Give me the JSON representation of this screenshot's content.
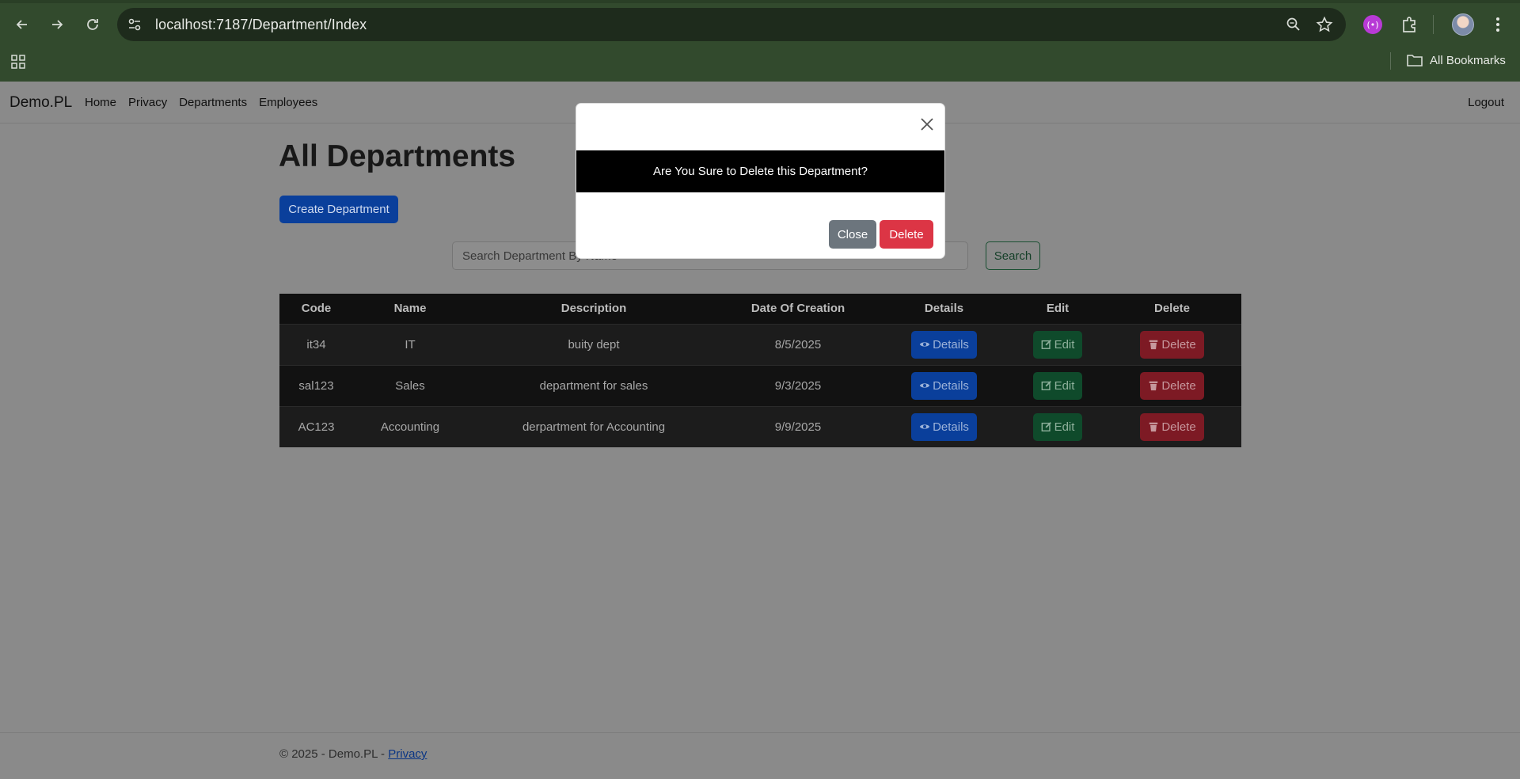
{
  "browser": {
    "url": "localhost:7187/Department/Index",
    "bookmarks_label": "All Bookmarks"
  },
  "navbar": {
    "brand": "Demo.PL",
    "links": [
      "Home",
      "Privacy",
      "Departments",
      "Employees"
    ],
    "logout": "Logout"
  },
  "main": {
    "title": "All Departments",
    "create_label": "Create Department",
    "search_placeholder": "Search Department By Name",
    "search_label": "Search"
  },
  "table": {
    "headers": [
      "Code",
      "Name",
      "Description",
      "Date Of Creation",
      "Details",
      "Edit",
      "Delete"
    ],
    "rows": [
      {
        "code": "it34",
        "name": "IT",
        "description": "buity dept",
        "date": "8/5/2025"
      },
      {
        "code": "sal123",
        "name": "Sales",
        "description": "department for sales",
        "date": "9/3/2025"
      },
      {
        "code": "AC123",
        "name": "Accounting",
        "description": "derpartment for Accounting",
        "date": "9/9/2025"
      }
    ],
    "details_label": "Details",
    "edit_label": "Edit",
    "delete_label": "Delete"
  },
  "footer": {
    "text": "© 2025 - Demo.PL - ",
    "privacy_link": "Privacy"
  },
  "modal": {
    "message": "Are You Sure to Delete this Department?",
    "close_label": "Close",
    "delete_label": "Delete"
  },
  "colors": {
    "primary": "#0d6efd",
    "success": "#198754",
    "danger": "#dc3545",
    "secondary": "#6c757d",
    "chrome": "#324a2d"
  }
}
